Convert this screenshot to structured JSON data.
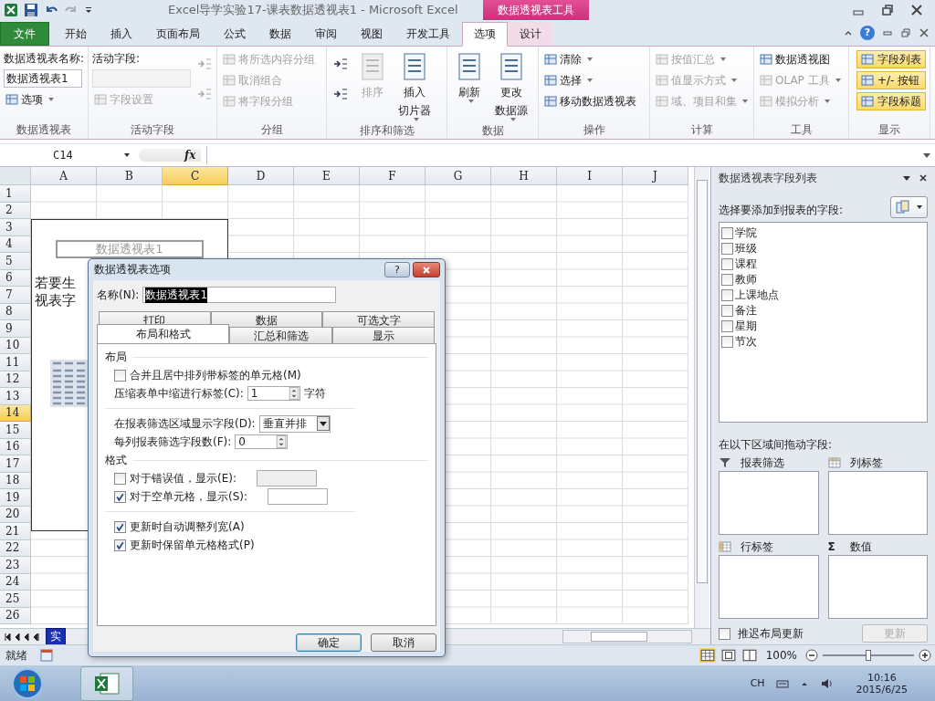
{
  "title_bar": {
    "title": "Excel导学实验17-课表数据透视表1  -  Microsoft Excel",
    "context_tab": "数据透视表工具"
  },
  "ribbon_tabs": [
    {
      "label": "文件",
      "kind": "file",
      "selected": false
    },
    {
      "label": "开始",
      "kind": "tab",
      "selected": false
    },
    {
      "label": "插入",
      "kind": "tab",
      "selected": false
    },
    {
      "label": "页面布局",
      "kind": "tab",
      "selected": false
    },
    {
      "label": "公式",
      "kind": "tab",
      "selected": false
    },
    {
      "label": "数据",
      "kind": "tab",
      "selected": false
    },
    {
      "label": "审阅",
      "kind": "tab",
      "selected": false
    },
    {
      "label": "视图",
      "kind": "tab",
      "selected": false
    },
    {
      "label": "开发工具",
      "kind": "tab",
      "selected": false
    },
    {
      "label": "选项",
      "kind": "context",
      "selected": true
    },
    {
      "label": "设计",
      "kind": "context",
      "selected": false
    }
  ],
  "help_label": "?",
  "ribbon_groups": [
    {
      "title": "数据透视表",
      "columns": [
        [
          {
            "kind": "label",
            "label": "数据透视表名称:"
          },
          {
            "kind": "field",
            "value": "数据透视表1",
            "disabled": false
          },
          {
            "kind": "small",
            "label": "选项",
            "dropdown": true,
            "disabled": false
          }
        ]
      ]
    },
    {
      "title": "活动字段",
      "columns": [
        [
          {
            "kind": "label",
            "label": "活动字段:"
          },
          {
            "kind": "field",
            "disabled": true
          },
          {
            "kind": "small",
            "label": "字段设置",
            "dropdown": false,
            "disabled": true
          }
        ],
        [
          {
            "kind": "icon",
            "disabled": true
          },
          {
            "kind": "icon",
            "disabled": true
          }
        ]
      ]
    },
    {
      "title": "分组",
      "columns": [
        [
          {
            "kind": "small",
            "label": "将所选内容分组",
            "dropdown": false,
            "disabled": true
          },
          {
            "kind": "small",
            "label": "取消组合",
            "dropdown": false,
            "disabled": true
          },
          {
            "kind": "small",
            "label": "将字段分组",
            "dropdown": false,
            "disabled": true
          }
        ]
      ]
    },
    {
      "title": "排序和筛选",
      "columns": [
        [
          {
            "kind": "icon",
            "disabled": false
          },
          {
            "kind": "icon",
            "disabled": false
          }
        ],
        [
          {
            "kind": "large",
            "lines": [
              "排序"
            ],
            "dropdown": false,
            "disabled": true
          }
        ],
        [
          {
            "kind": "large",
            "lines": [
              "插入",
              "切片器"
            ],
            "dropdown": true,
            "disabled": false
          }
        ]
      ]
    },
    {
      "title": "数据",
      "columns": [
        [
          {
            "kind": "large",
            "lines": [
              "刷新"
            ],
            "dropdown": true,
            "disabled": false
          }
        ],
        [
          {
            "kind": "large",
            "lines": [
              "更改",
              "数据源"
            ],
            "dropdown": true,
            "disabled": false
          }
        ]
      ]
    },
    {
      "title": "操作",
      "columns": [
        [
          {
            "kind": "small",
            "label": "清除",
            "dropdown": true,
            "disabled": false
          },
          {
            "kind": "small",
            "label": "选择",
            "dropdown": true,
            "disabled": false
          },
          {
            "kind": "small",
            "label": "移动数据透视表",
            "dropdown": false,
            "disabled": false
          }
        ]
      ]
    },
    {
      "title": "计算",
      "columns": [
        [
          {
            "kind": "small",
            "label": "按值汇总",
            "dropdown": true,
            "disabled": true
          },
          {
            "kind": "small",
            "label": "值显示方式",
            "dropdown": true,
            "disabled": true
          },
          {
            "kind": "small",
            "label": "域、项目和集",
            "dropdown": true,
            "disabled": true
          }
        ]
      ]
    },
    {
      "title": "工具",
      "columns": [
        [
          {
            "kind": "small",
            "label": "数据透视图",
            "dropdown": false,
            "disabled": false
          },
          {
            "kind": "small",
            "label": "OLAP 工具",
            "dropdown": true,
            "disabled": true
          },
          {
            "kind": "small",
            "label": "模拟分析",
            "dropdown": true,
            "disabled": true
          }
        ]
      ]
    },
    {
      "title": "显示",
      "columns": [
        [
          {
            "kind": "toggle",
            "label": "字段列表",
            "on": true
          },
          {
            "kind": "toggle",
            "label": "+/- 按钮",
            "on": true
          },
          {
            "kind": "toggle",
            "label": "字段标题",
            "on": true
          }
        ]
      ]
    }
  ],
  "formula_bar": {
    "name_box": "C14",
    "function_label": "fx"
  },
  "sheet": {
    "columns": [
      {
        "label": "A",
        "selected": false
      },
      {
        "label": "B",
        "selected": false
      },
      {
        "label": "C",
        "selected": true
      },
      {
        "label": "D",
        "selected": false
      },
      {
        "label": "E",
        "selected": false
      },
      {
        "label": "F",
        "selected": false
      },
      {
        "label": "G",
        "selected": false
      },
      {
        "label": "H",
        "selected": false
      },
      {
        "label": "I",
        "selected": false
      },
      {
        "label": "J",
        "selected": false
      }
    ],
    "rows": [
      {
        "label": "1",
        "selected": false
      },
      {
        "label": "2",
        "selected": false
      },
      {
        "label": "3",
        "selected": false
      },
      {
        "label": "4",
        "selected": false
      },
      {
        "label": "5",
        "selected": false
      },
      {
        "label": "6",
        "selected": false
      },
      {
        "label": "7",
        "selected": false
      },
      {
        "label": "8",
        "selected": false
      },
      {
        "label": "9",
        "selected": false
      },
      {
        "label": "10",
        "selected": false
      },
      {
        "label": "11",
        "selected": false
      },
      {
        "label": "12",
        "selected": false
      },
      {
        "label": "13",
        "selected": false
      },
      {
        "label": "14",
        "selected": true
      },
      {
        "label": "15",
        "selected": false
      },
      {
        "label": "16",
        "selected": false
      },
      {
        "label": "17",
        "selected": false
      },
      {
        "label": "18",
        "selected": false
      },
      {
        "label": "19",
        "selected": false
      },
      {
        "label": "20",
        "selected": false
      },
      {
        "label": "21",
        "selected": false
      },
      {
        "label": "22",
        "selected": false
      },
      {
        "label": "23",
        "selected": false
      },
      {
        "label": "24",
        "selected": false
      },
      {
        "label": "25",
        "selected": false
      },
      {
        "label": "26",
        "selected": false
      }
    ],
    "pivot_placeholder": {
      "caption": "数据透视表1",
      "hint_lines": [
        "若要生",
        "视表字"
      ]
    },
    "sheet_tab": "实"
  },
  "field_list": {
    "title": "数据透视表字段列表",
    "prompt": "选择要添加到报表的字段:",
    "fields": [
      {
        "label": "学院",
        "checked": false
      },
      {
        "label": "班级",
        "checked": false
      },
      {
        "label": "课程",
        "checked": false
      },
      {
        "label": "教师",
        "checked": false
      },
      {
        "label": "上课地点",
        "checked": false
      },
      {
        "label": "备注",
        "checked": false
      },
      {
        "label": "星期",
        "checked": false
      },
      {
        "label": "节次",
        "checked": false
      }
    ],
    "areas_prompt": "在以下区域间拖动字段:",
    "areas": [
      {
        "kind": "filter",
        "label": "报表筛选"
      },
      {
        "kind": "columns",
        "label": "列标签"
      },
      {
        "kind": "rows",
        "label": "行标签"
      },
      {
        "kind": "values",
        "label": "数值",
        "symbol": "Σ"
      }
    ],
    "defer": {
      "label": "推迟布局更新",
      "checked": false
    },
    "update_button": {
      "label": "更新",
      "disabled": true
    }
  },
  "status_bar": {
    "status": "就绪",
    "zoom": {
      "label": "100%",
      "level": 0.5
    }
  },
  "dialog": {
    "title": "数据透视表选项",
    "help": "?",
    "name_label": "名称(N):",
    "name_value": "数据透视表1",
    "tab_rows": [
      [
        {
          "label": "打印",
          "selected": false
        },
        {
          "label": "数据",
          "selected": false
        },
        {
          "label": "可选文字",
          "selected": false
        }
      ],
      [
        {
          "label": "布局和格式",
          "selected": true
        },
        {
          "label": "汇总和筛选",
          "selected": false
        },
        {
          "label": "显示",
          "selected": false
        }
      ]
    ],
    "items": [
      {
        "kind": "heading",
        "label": "布局"
      },
      {
        "kind": "checkbox",
        "label": "合并且居中排列带标签的单元格(M)",
        "checked": false
      },
      {
        "kind": "spinner",
        "label": "压缩表单中缩进行标签(C):",
        "value": "1",
        "suffix": "字符"
      },
      {
        "kind": "divider"
      },
      {
        "kind": "select",
        "label": "在报表筛选区域显示字段(D):",
        "value": "垂直并排"
      },
      {
        "kind": "spinner",
        "label": "每列报表筛选字段数(F):",
        "value": "0"
      },
      {
        "kind": "heading",
        "label": "格式"
      },
      {
        "kind": "check_field",
        "label": "对于错误值，显示(E):",
        "checked": false
      },
      {
        "kind": "check_field",
        "label": "对于空单元格，显示(S):",
        "checked": true
      },
      {
        "kind": "divider"
      },
      {
        "kind": "checkbox",
        "label": "更新时自动调整列宽(A)",
        "checked": true
      },
      {
        "kind": "checkbox",
        "label": "更新时保留单元格格式(P)",
        "checked": true
      }
    ],
    "buttons": [
      {
        "label": "确定",
        "default": true
      },
      {
        "label": "取消",
        "default": false
      }
    ]
  },
  "taskbar": {
    "language": "CH",
    "time": "10:16",
    "date": "2015/6/25"
  }
}
